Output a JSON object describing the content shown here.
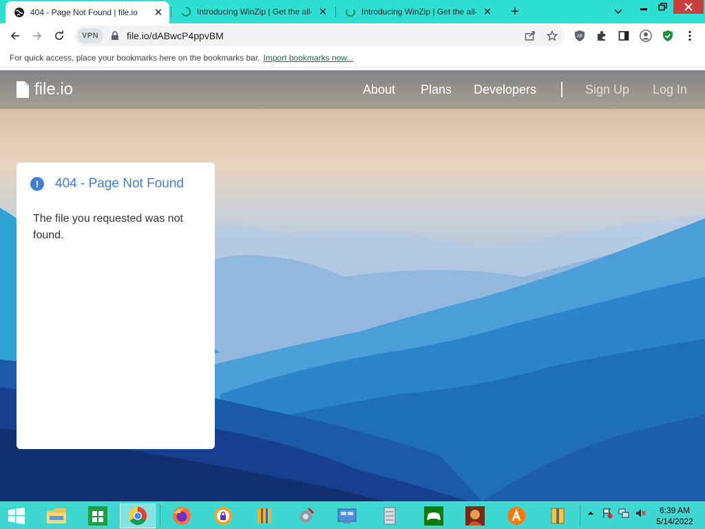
{
  "browser": {
    "tabs": [
      {
        "title": "404 - Page Not Found | file.io",
        "active": true
      },
      {
        "title": "Introducing WinZip | Get the all-",
        "active": false
      },
      {
        "title": "Introducing WinZip | Get the all-",
        "active": false
      }
    ],
    "url": "file.io/dABwcP4ppvBM",
    "vpn_label": "VPN",
    "bookmarks_prompt": "For quick access, place your bookmarks here on the bookmarks bar.",
    "bookmarks_link": "Import bookmarks now..."
  },
  "site": {
    "brand": "file.io",
    "nav": [
      "About",
      "Plans",
      "Developers"
    ],
    "auth": [
      "Sign Up",
      "Log In"
    ]
  },
  "error_card": {
    "title": "404 - Page Not Found",
    "message": "The file you requested was not found."
  },
  "taskbar": {
    "time": "6:39 AM",
    "date": "5/14/2022",
    "apps": [
      "start",
      "file-explorer",
      "store",
      "chrome",
      "firefox",
      "vpn-app",
      "archive-app",
      "system-tool",
      "control-panel",
      "server-manager",
      "xbox",
      "game",
      "avast",
      "winzip"
    ]
  },
  "colors": {
    "tabstrip": "#2ee0d2",
    "accent_blue": "#3d7fd6",
    "taskbar": "#3fd7d2"
  }
}
